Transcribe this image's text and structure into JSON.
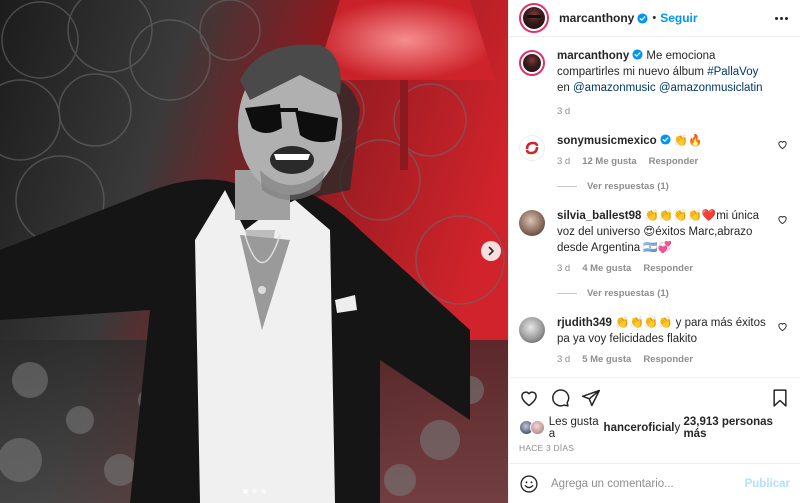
{
  "post": {
    "author": "marcanthony",
    "follow_label": "Seguir",
    "separator": "•",
    "caption": {
      "author": "marcanthony",
      "text_1": " Me emociona compartirles mi nuevo álbum ",
      "hashtag": "#PallaVoy",
      "text_2": " en ",
      "mention_1": "@amazonmusic",
      "text_3": " ",
      "mention_2": "@amazonmusiclatin",
      "age": "3 d"
    },
    "media": {
      "next_icon": "chevron-right-icon",
      "slide_count": 3,
      "active_slide": 1
    }
  },
  "comments": [
    {
      "author": "sonymusicmexico",
      "verified": true,
      "text": " 👏🔥",
      "age": "3 d",
      "likes": "12 Me gusta",
      "reply": "Responder",
      "replies": "Ver respuestas (1)"
    },
    {
      "author": "silvia_ballest98",
      "verified": false,
      "text": " 👏👏👏👏❤️mi única voz del universo 😍éxitos Marc,abrazo desde Argentina 🇦🇷💞",
      "age": "3 d",
      "likes": "4 Me gusta",
      "reply": "Responder",
      "replies": "Ver respuestas (1)"
    },
    {
      "author": "rjudith349",
      "verified": false,
      "text": " 👏👏👏👏 y para más éxitos pa ya voy felicidades flakito",
      "age": "3 d",
      "likes": "5 Me gusta",
      "reply": "Responder",
      "replies": ""
    }
  ],
  "likes": {
    "prefix": "Les gusta a ",
    "user": "hanceroficial",
    "mid": " y ",
    "count": "23,913 personas más"
  },
  "date": "HACE 3 DÍAS",
  "add_comment": {
    "placeholder": "Agrega un comentario...",
    "publish": "Publicar"
  },
  "icons": {
    "like": "heart-icon",
    "comment": "comment-icon",
    "share": "paper-plane-icon",
    "save": "bookmark-icon",
    "emoji": "smiley-icon",
    "more": "more-horizontal-icon",
    "verified": "verified-badge-icon"
  },
  "colors": {
    "link": "#00376b",
    "follow": "#0095f6",
    "verified": "#0095f6",
    "publish_disabled": "#b2dffc",
    "muted": "#8e8e8e",
    "photo_accent": "#c8202a"
  }
}
